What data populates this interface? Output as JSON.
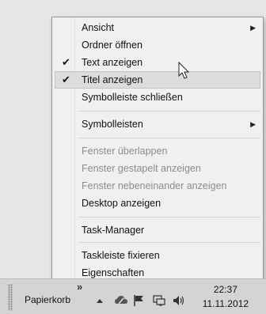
{
  "context_menu": {
    "items": [
      {
        "label": "Ansicht"
      },
      {
        "label": "Ordner öffnen"
      },
      {
        "label": "Text anzeigen"
      },
      {
        "label": "Titel anzeigen"
      },
      {
        "label": "Symbolleiste schließen"
      },
      {
        "label": "Symbolleisten"
      },
      {
        "label": "Fenster überlappen"
      },
      {
        "label": "Fenster gestapelt anzeigen"
      },
      {
        "label": "Fenster nebeneinander anzeigen"
      },
      {
        "label": "Desktop anzeigen"
      },
      {
        "label": "Task-Manager"
      },
      {
        "label": "Taskleiste fixieren"
      },
      {
        "label": "Eigenschaften"
      }
    ],
    "checked": [
      "Text anzeigen",
      "Titel anzeigen"
    ],
    "hovered": "Titel anzeigen",
    "submenu_items": [
      "Ansicht",
      "Symbolleisten"
    ],
    "disabled": [
      "Fenster überlappen",
      "Fenster gestapelt anzeigen",
      "Fenster nebeneinander anzeigen"
    ]
  },
  "taskbar": {
    "toolbar_label": "Papierkorb",
    "overflow_glyph": "»",
    "tray_icons": [
      "up-arrow-icon",
      "cloud-icon",
      "flag-icon",
      "network-icon",
      "speaker-icon"
    ],
    "clock": {
      "time": "22:37",
      "date": "11.11.2012"
    }
  }
}
